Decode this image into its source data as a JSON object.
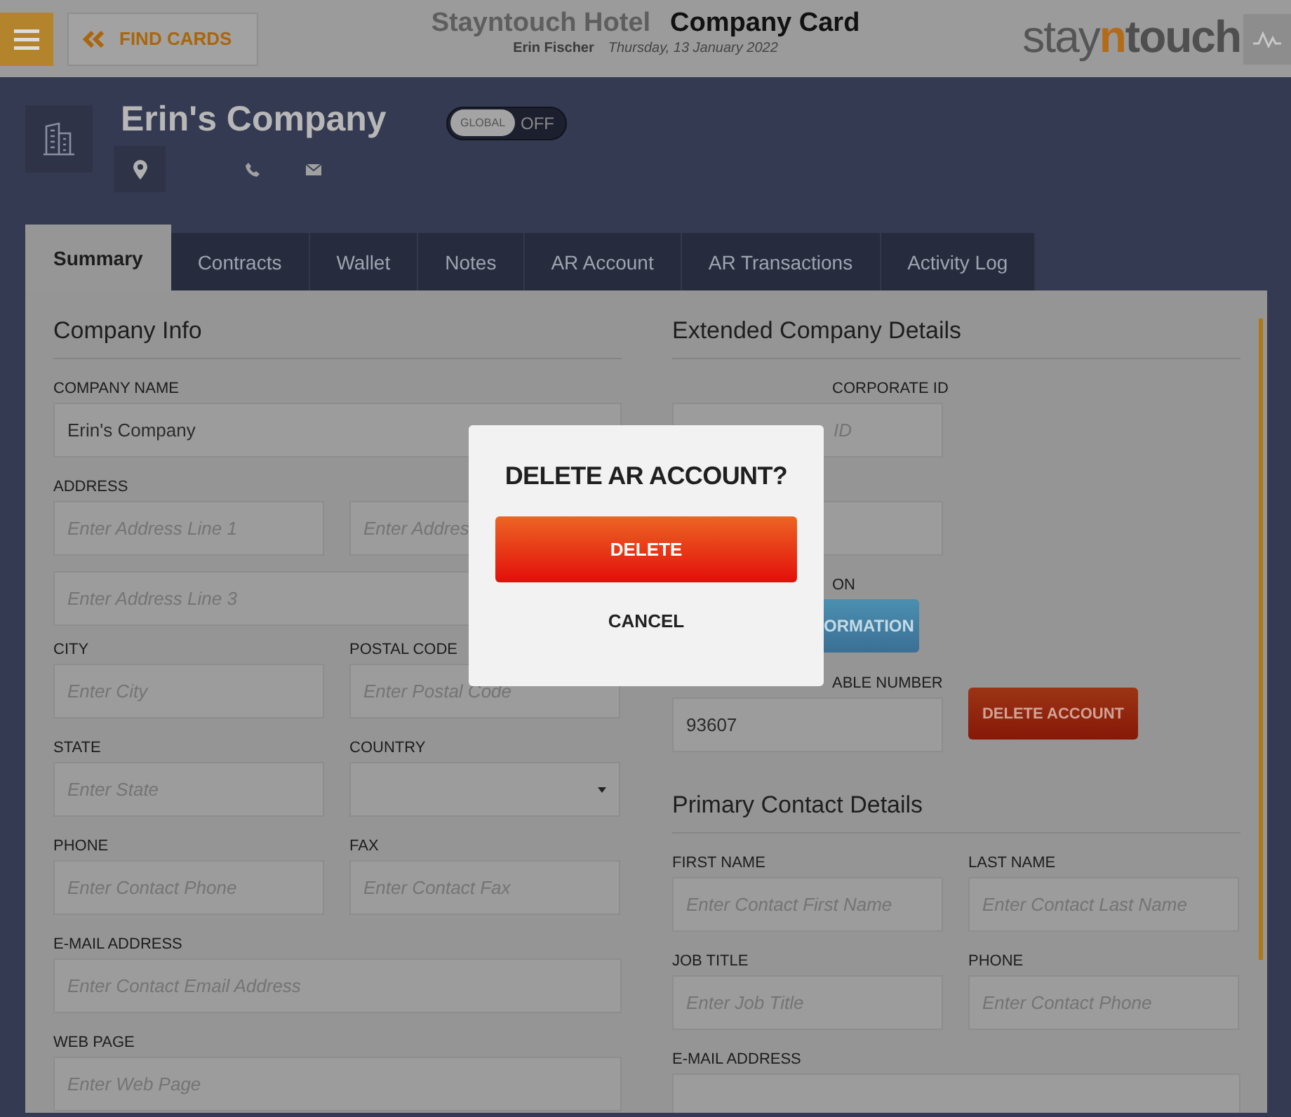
{
  "header": {
    "find_button": "FIND CARDS",
    "hotel": "Stayntouch Hotel",
    "title": "Company Card",
    "user": "Erin Fischer",
    "date": "Thursday, 13 January 2022",
    "logo": {
      "before": "stay",
      "accent": "n",
      "after": "touch"
    }
  },
  "company": {
    "name": "Erin's Company",
    "toggle": {
      "label": "GLOBAL",
      "state": "OFF",
      "on": false
    }
  },
  "tabs": [
    {
      "label": "Summary",
      "selected": true
    },
    {
      "label": "Contracts",
      "selected": false
    },
    {
      "label": "Wallet",
      "selected": false
    },
    {
      "label": "Notes",
      "selected": false
    },
    {
      "label": "AR Account",
      "selected": false
    },
    {
      "label": "AR Transactions",
      "selected": false
    },
    {
      "label": "Activity Log",
      "selected": false
    }
  ],
  "left": {
    "heading": "Company Info",
    "rows": [
      {
        "cells": [
          {
            "kind": "field",
            "label": "COMPANY NAME",
            "value": "Erin's Company",
            "wide": true
          }
        ]
      },
      {
        "cells": [
          {
            "kind": "field",
            "label": "ADDRESS",
            "placeholder": "Enter Address Line 1"
          },
          {
            "kind": "field",
            "placeholder": "Enter Addres"
          }
        ]
      },
      {
        "cells": [
          {
            "kind": "field",
            "placeholder": "Enter Address Line 3",
            "wide": true
          }
        ]
      },
      {
        "cells": [
          {
            "kind": "field",
            "label": "CITY",
            "placeholder": "Enter City"
          },
          {
            "kind": "field",
            "label": "POSTAL CODE",
            "placeholder": "Enter Postal Code"
          }
        ]
      },
      {
        "cells": [
          {
            "kind": "field",
            "label": "STATE",
            "placeholder": "Enter State"
          },
          {
            "kind": "select",
            "label": "COUNTRY"
          }
        ]
      },
      {
        "cells": [
          {
            "kind": "field",
            "label": "PHONE",
            "placeholder": "Enter Contact Phone"
          },
          {
            "kind": "field",
            "label": "FAX",
            "placeholder": "Enter Contact Fax"
          }
        ]
      },
      {
        "cells": [
          {
            "kind": "field",
            "label": "E-MAIL ADDRESS",
            "placeholder": "Enter Contact Email Address",
            "wide": true
          }
        ]
      },
      {
        "cells": [
          {
            "kind": "field",
            "label": "WEB PAGE",
            "placeholder": "Enter Web Page",
            "wide": true
          }
        ]
      }
    ]
  },
  "right": {
    "heading": "Extended Company Details",
    "rows": [
      {
        "cells": [
          {
            "kind": "field",
            "label": "CORPORATE ID",
            "placeholder": "ID"
          }
        ]
      },
      {
        "cells": [
          {
            "kind": "field"
          }
        ]
      },
      {
        "cells": [
          {
            "kind": "button",
            "label": "ON",
            "text": "ORMATION"
          }
        ]
      },
      {
        "cells": [
          {
            "kind": "field",
            "label": "ABLE NUMBER",
            "value": "93607"
          },
          {
            "kind": "danger",
            "text": "DELETE ACCOUNT"
          }
        ]
      }
    ]
  },
  "contact": {
    "heading": "Primary Contact Details",
    "rows": [
      {
        "cells": [
          {
            "kind": "field",
            "label": "FIRST NAME",
            "placeholder": "Enter Contact First Name"
          },
          {
            "kind": "field",
            "label": "LAST NAME",
            "placeholder": "Enter Contact Last Name"
          }
        ]
      },
      {
        "cells": [
          {
            "kind": "field",
            "label": "JOB TITLE",
            "placeholder": "Enter Job Title"
          },
          {
            "kind": "field",
            "label": "PHONE",
            "placeholder": "Enter Contact Phone"
          }
        ]
      },
      {
        "cells": [
          {
            "kind": "field",
            "label": "E-MAIL ADDRESS",
            "wide": true
          }
        ]
      }
    ]
  },
  "dialog": {
    "title": "DELETE AR ACCOUNT?",
    "confirm": "DELETE",
    "cancel": "CANCEL"
  }
}
